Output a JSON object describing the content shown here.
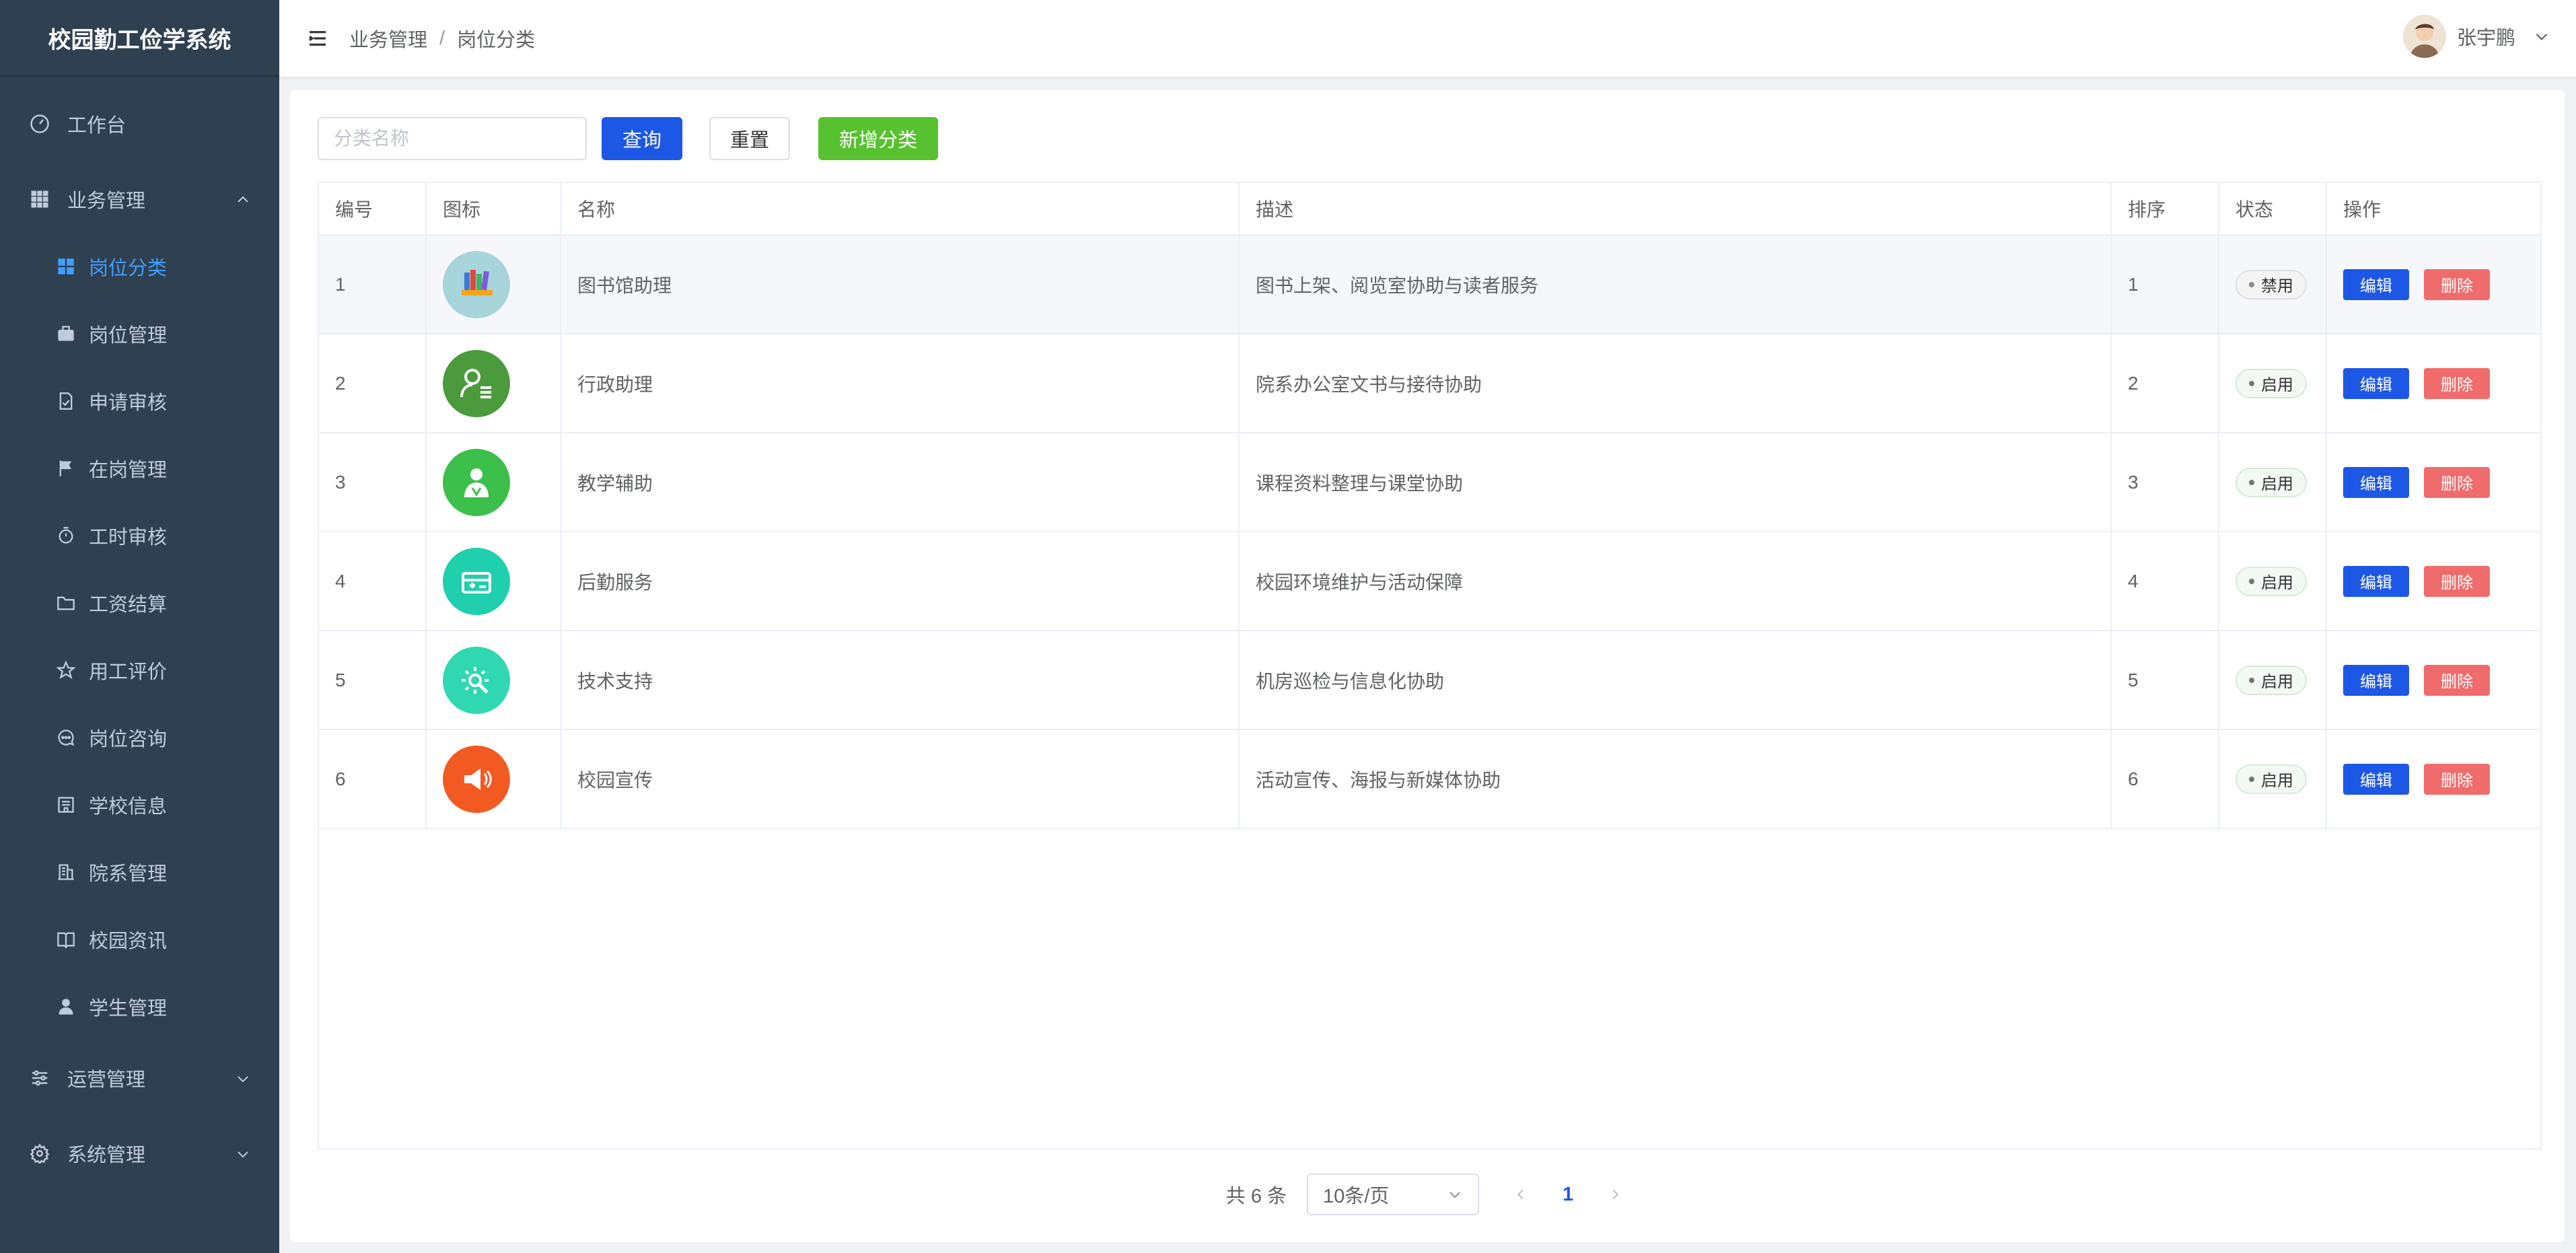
{
  "sidebar": {
    "title": "校园勤工俭学系统",
    "workbench": "工作台",
    "business": "业务管理",
    "items": [
      {
        "label": "岗位分类",
        "icon": "grid-icon",
        "active": true
      },
      {
        "label": "岗位管理",
        "icon": "briefcase-icon"
      },
      {
        "label": "申请审核",
        "icon": "document-check-icon"
      },
      {
        "label": "在岗管理",
        "icon": "flag-icon"
      },
      {
        "label": "工时审核",
        "icon": "stopwatch-icon"
      },
      {
        "label": "工资结算",
        "icon": "folder-icon"
      },
      {
        "label": "用工评价",
        "icon": "star-icon"
      },
      {
        "label": "岗位咨询",
        "icon": "chat-icon"
      },
      {
        "label": "学校信息",
        "icon": "school-icon"
      },
      {
        "label": "院系管理",
        "icon": "building-icon"
      },
      {
        "label": "校园资讯",
        "icon": "book-icon"
      },
      {
        "label": "学生管理",
        "icon": "user-icon"
      }
    ],
    "operations": "运营管理",
    "system": "系统管理"
  },
  "header": {
    "breadcrumb": [
      "业务管理",
      "岗位分类"
    ],
    "separator": "/",
    "username": "张宇鹏"
  },
  "toolbar": {
    "search_placeholder": "分类名称",
    "query_label": "查询",
    "reset_label": "重置",
    "add_label": "新增分类"
  },
  "table": {
    "columns": [
      "编号",
      "图标",
      "名称",
      "描述",
      "排序",
      "状态",
      "操作"
    ],
    "edit_label": "编辑",
    "delete_label": "删除",
    "rows": [
      {
        "id": "1",
        "name": "图书馆助理",
        "desc": "图书上架、阅览室协助与读者服务",
        "sort": "1",
        "status": "禁用",
        "icon": "books-icon",
        "icon_color": "#a8d4dc"
      },
      {
        "id": "2",
        "name": "行政助理",
        "desc": "院系办公室文书与接待协助",
        "sort": "2",
        "status": "启用",
        "icon": "person-list-icon",
        "icon_color": "#4b9a3c"
      },
      {
        "id": "3",
        "name": "教学辅助",
        "desc": "课程资料整理与课堂协助",
        "sort": "3",
        "status": "启用",
        "icon": "teacher-icon",
        "icon_color": "#3dbf4b"
      },
      {
        "id": "4",
        "name": "后勤服务",
        "desc": "校园环境维护与活动保障",
        "sort": "4",
        "status": "启用",
        "icon": "toolbox-icon",
        "icon_color": "#1fcfae"
      },
      {
        "id": "5",
        "name": "技术支持",
        "desc": "机房巡检与信息化协助",
        "sort": "5",
        "status": "启用",
        "icon": "gear-wrench-icon",
        "icon_color": "#2fd8b0"
      },
      {
        "id": "6",
        "name": "校园宣传",
        "desc": "活动宣传、海报与新媒体协助",
        "sort": "6",
        "status": "启用",
        "icon": "megaphone-icon",
        "icon_color": "#f25a22"
      }
    ]
  },
  "pagination": {
    "total": "共 6 条",
    "page_size": "10条/页",
    "current": "1"
  }
}
